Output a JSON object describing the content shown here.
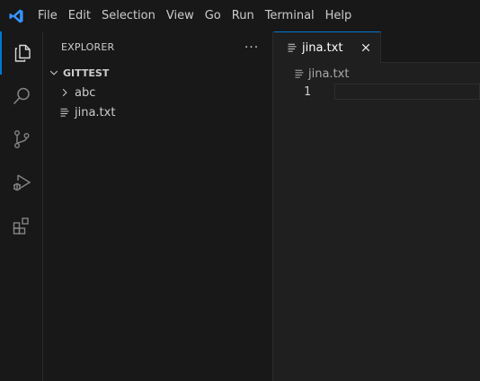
{
  "menu": {
    "items": [
      "File",
      "Edit",
      "Selection",
      "View",
      "Go",
      "Run",
      "Terminal",
      "Help"
    ]
  },
  "activity_bar": {
    "items": [
      "explorer-icon",
      "search-icon",
      "source-control-icon",
      "run-debug-icon",
      "extensions-icon"
    ],
    "active": "explorer-icon"
  },
  "sidebar": {
    "title": "EXPLORER",
    "more_label": "···",
    "section_title": "GITTEST",
    "tree": [
      {
        "label": "abc",
        "kind": "folder"
      },
      {
        "label": "jina.txt",
        "kind": "file"
      }
    ]
  },
  "editor": {
    "tab_label": "jina.txt",
    "breadcrumb_label": "jina.txt",
    "line_number": "1"
  },
  "colors": {
    "accent": "#0078d4",
    "titlebar_bg": "#181818",
    "editor_bg": "#1f1f1f",
    "vscode_blue": "#3794ff"
  }
}
